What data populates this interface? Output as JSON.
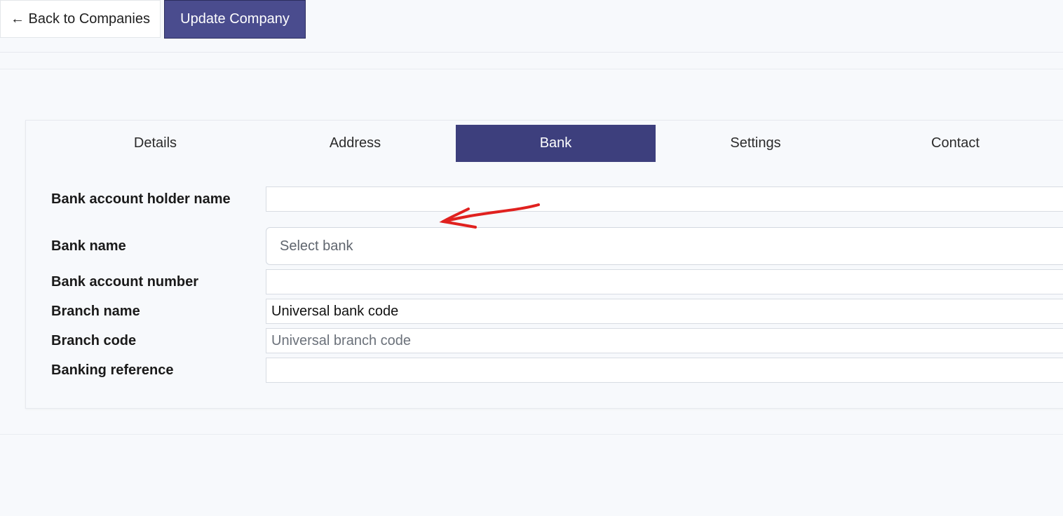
{
  "toolbar": {
    "back_label": "← Back to Companies",
    "update_label": "Update Company"
  },
  "tabs": [
    {
      "label": "Details",
      "active": false
    },
    {
      "label": "Address",
      "active": false
    },
    {
      "label": "Bank",
      "active": true
    },
    {
      "label": "Settings",
      "active": false
    },
    {
      "label": "Contact",
      "active": false
    }
  ],
  "form": {
    "account_holder": {
      "label": "Bank account holder name",
      "value": ""
    },
    "bank_name": {
      "label": "Bank name",
      "placeholder": "Select bank"
    },
    "account_number": {
      "label": "Bank account number",
      "value": ""
    },
    "branch_name": {
      "label": "Branch name",
      "value": "Universal bank code"
    },
    "branch_code": {
      "label": "Branch code",
      "placeholder": "Universal branch code"
    },
    "banking_reference": {
      "label": "Banking reference",
      "value": ""
    }
  },
  "colors": {
    "primary": "#3d3f7d",
    "annotation": "#e0211f"
  }
}
